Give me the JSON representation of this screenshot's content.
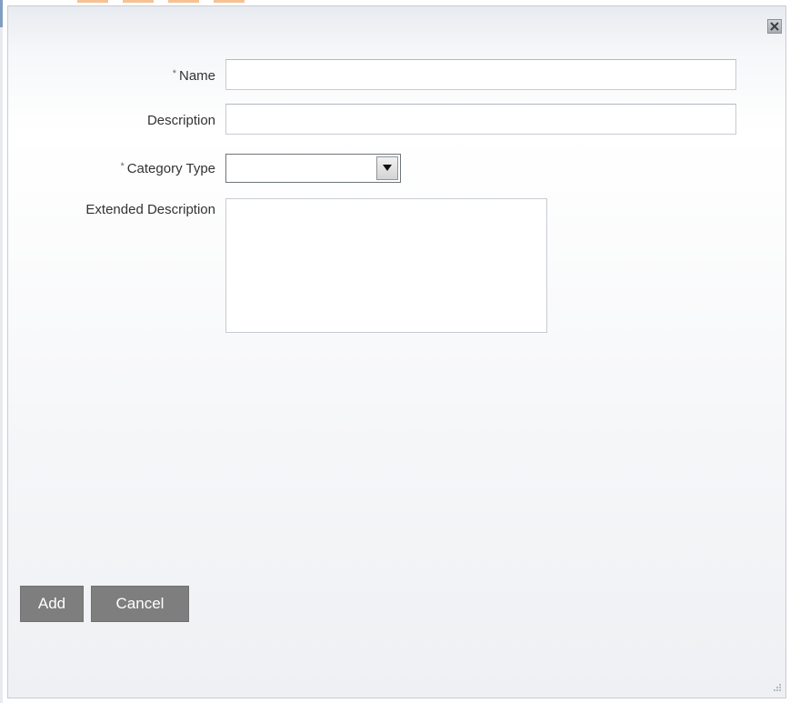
{
  "dialog": {
    "close_label": "Close"
  },
  "form": {
    "name": {
      "required_marker": "*",
      "label": "Name",
      "value": "",
      "placeholder": ""
    },
    "description": {
      "label": "Description",
      "value": "",
      "placeholder": ""
    },
    "category_type": {
      "required_marker": "*",
      "label": "Category Type",
      "selected": ""
    },
    "extended_description": {
      "label": "Extended Description",
      "value": ""
    }
  },
  "buttons": {
    "add": "Add",
    "cancel": "Cancel"
  },
  "icons": {
    "close": "close-icon",
    "dropdown": "chevron-down-icon",
    "resize": "resize-grip-icon"
  }
}
